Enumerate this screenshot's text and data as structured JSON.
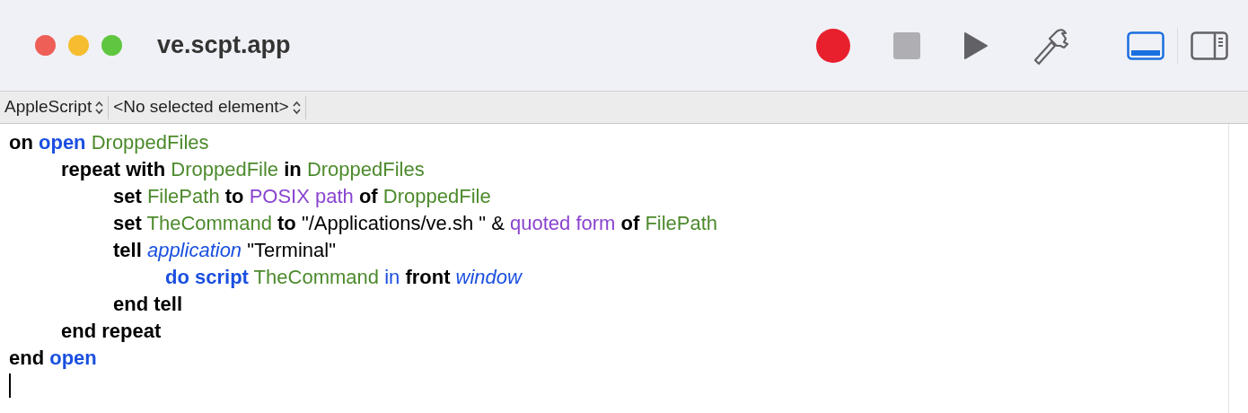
{
  "window": {
    "title": "ve.scpt.app"
  },
  "toolbar": [
    {
      "kind": "record"
    },
    {
      "kind": "stop"
    },
    {
      "kind": "run"
    },
    {
      "kind": "compile"
    }
  ],
  "view_toggles": [
    {
      "kind": "bottom",
      "selected": true
    },
    {
      "kind": "side",
      "selected": false
    }
  ],
  "navigation_bar": [
    {
      "label": "AppleScript"
    },
    {
      "label": "<No selected element>"
    }
  ],
  "script": [
    {
      "tokens": [
        {
          "kind": "keyword",
          "text": "on"
        },
        {
          "kind": "command",
          "text": "open"
        },
        {
          "kind": "variable",
          "text": "DroppedFiles"
        }
      ],
      "children": [
        {
          "tokens": [
            {
              "kind": "keyword",
              "text": "repeat with"
            },
            {
              "kind": "variable",
              "text": "DroppedFile"
            },
            {
              "kind": "keyword",
              "text": "in"
            },
            {
              "kind": "variable",
              "text": "DroppedFiles"
            }
          ],
          "children": [
            {
              "tokens": [
                {
                  "kind": "keyword",
                  "text": "set"
                },
                {
                  "kind": "variable",
                  "text": "FilePath"
                },
                {
                  "kind": "keyword",
                  "text": "to"
                },
                {
                  "kind": "property",
                  "text": "POSIX path"
                },
                {
                  "kind": "keyword",
                  "text": "of"
                },
                {
                  "kind": "variable",
                  "text": "DroppedFile"
                }
              ]
            },
            {
              "tokens": [
                {
                  "kind": "keyword",
                  "text": "set"
                },
                {
                  "kind": "variable",
                  "text": "TheCommand"
                },
                {
                  "kind": "keyword",
                  "text": "to"
                },
                {
                  "kind": "string",
                  "text": "\"/Applications/ve.sh \""
                },
                {
                  "kind": "string",
                  "text": "&"
                },
                {
                  "kind": "property",
                  "text": "quoted form"
                },
                {
                  "kind": "keyword",
                  "text": "of"
                },
                {
                  "kind": "variable",
                  "text": "FilePath"
                }
              ]
            },
            {
              "tokens": [
                {
                  "kind": "keyword",
                  "text": "tell"
                },
                {
                  "kind": "class",
                  "text": "application"
                },
                {
                  "kind": "string",
                  "text": "\"Terminal\""
                }
              ],
              "children": [
                {
                  "tokens": [
                    {
                      "kind": "command",
                      "text": "do script"
                    },
                    {
                      "kind": "variable",
                      "text": "TheCommand"
                    },
                    {
                      "kind": "parameter",
                      "text": "in"
                    },
                    {
                      "kind": "keyword",
                      "text": "front"
                    },
                    {
                      "kind": "class",
                      "text": "window"
                    }
                  ]
                }
              ]
            },
            {
              "tokens": [
                {
                  "kind": "keyword",
                  "text": "end tell"
                }
              ]
            }
          ]
        },
        {
          "tokens": [
            {
              "kind": "keyword",
              "text": "end repeat"
            }
          ]
        }
      ]
    },
    {
      "tokens": [
        {
          "kind": "keyword",
          "text": "end"
        },
        {
          "kind": "command",
          "text": "open"
        }
      ]
    }
  ]
}
